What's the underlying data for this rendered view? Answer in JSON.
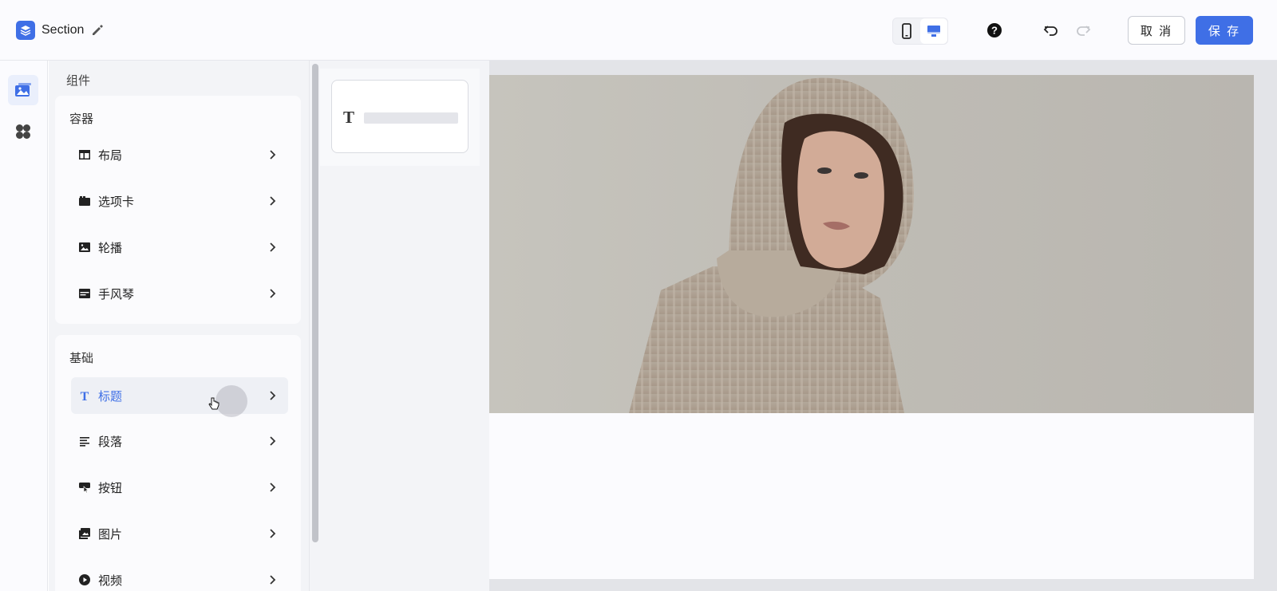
{
  "header": {
    "title": "Section",
    "cancel_label": "取 消",
    "save_label": "保 存",
    "accent_color": "#3f6fe6",
    "device_selected": "desktop"
  },
  "rail": {
    "items": [
      {
        "icon": "image-gallery-icon",
        "active": true
      },
      {
        "icon": "apps-clover-icon",
        "active": false
      }
    ]
  },
  "panel": {
    "title": "组件",
    "groups": [
      {
        "title": "容器",
        "items": [
          {
            "label": "布局",
            "icon": "layout-icon"
          },
          {
            "label": "选项卡",
            "icon": "tabs-icon"
          },
          {
            "label": "轮播",
            "icon": "carousel-icon"
          },
          {
            "label": "手风琴",
            "icon": "accordion-icon"
          }
        ]
      },
      {
        "title": "基础",
        "items": [
          {
            "label": "标题",
            "icon": "heading-icon",
            "hover": true
          },
          {
            "label": "段落",
            "icon": "paragraph-icon"
          },
          {
            "label": "按钮",
            "icon": "button-icon"
          },
          {
            "label": "图片",
            "icon": "image-icon"
          },
          {
            "label": "视频",
            "icon": "video-icon"
          }
        ]
      }
    ]
  },
  "preview": {
    "glyph": "T"
  }
}
